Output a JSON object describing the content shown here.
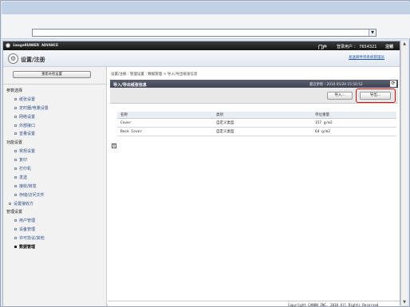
{
  "header": {
    "product": "imageRUNNER ADVANCE",
    "portal": "门户",
    "user_text": "登录用户 ： 7654321",
    "logout": "注销"
  },
  "subheader": {
    "title": "设置/注册",
    "send_link": "发送邮件到系统管理员"
  },
  "sidebar": {
    "button_label": "重新补给设置",
    "items": [
      {
        "label": "参数选择",
        "kind": "cat"
      },
      {
        "label": "纸张设置",
        "kind": "sub"
      },
      {
        "label": "定时器/电量设置",
        "kind": "sub"
      },
      {
        "label": "网络设置",
        "kind": "sub"
      },
      {
        "label": "外部接口",
        "kind": "sub"
      },
      {
        "label": "音量设置",
        "kind": "sub"
      },
      {
        "label": "功能设置",
        "kind": "cat"
      },
      {
        "label": "常规设置",
        "kind": "sub"
      },
      {
        "label": "复印",
        "kind": "sub"
      },
      {
        "label": "打印机",
        "kind": "sub"
      },
      {
        "label": "发送",
        "kind": "sub"
      },
      {
        "label": "接收/转发",
        "kind": "sub"
      },
      {
        "label": "存储/访问文件",
        "kind": "sub"
      },
      {
        "label": "设置接收方",
        "kind": "top"
      },
      {
        "label": "管理设置",
        "kind": "cat"
      },
      {
        "label": "用户管理",
        "kind": "sub"
      },
      {
        "label": "设备管理",
        "kind": "sub"
      },
      {
        "label": "许可协议/其他",
        "kind": "sub"
      },
      {
        "label": "数据管理",
        "kind": "sub-active"
      }
    ]
  },
  "content": {
    "breadcrumb": "设置/注册 : 管理设置 : 数据管理 > 导入/导出纸张信息",
    "panel_title": "导入/导出纸张信息",
    "last_update": "最近更新 : 2010 05/20 15:50:52",
    "import_label": "导入...",
    "export_label": "导出...",
    "columns": [
      "名称",
      "类别",
      "单位重量"
    ],
    "rows": [
      [
        "Cover",
        "自定义类型",
        "157 g/m2"
      ],
      [
        "Back Cover",
        "自定义类型",
        "64 g/m2"
      ]
    ]
  },
  "footer": {
    "copyright": "Copyright CANON INC. 2010 All Rights Reserved"
  }
}
